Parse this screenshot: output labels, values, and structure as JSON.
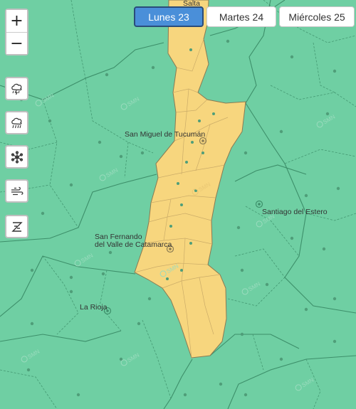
{
  "zoom": {
    "in_label": "+",
    "out_label": "−"
  },
  "layers": [
    {
      "name": "storm-icon"
    },
    {
      "name": "rain-icon"
    },
    {
      "name": "snow-icon"
    },
    {
      "name": "wind-icon"
    },
    {
      "name": "zonda-icon"
    }
  ],
  "days": [
    {
      "label": "Lunes 23",
      "selected": true
    },
    {
      "label": "Martes 24",
      "selected": false
    },
    {
      "label": "Miércoles 25",
      "selected": false
    }
  ],
  "map": {
    "labels": {
      "salta": "Salta",
      "tucuman": "San Miguel de Tucumán",
      "santiago": "Santiago del Estero",
      "catamarca_line1": "San Fernando",
      "catamarca_line2": "del Valle de Catamarca",
      "larioja": "La Rioja"
    },
    "watermark": "SMN",
    "colors": {
      "background": "#6fcfa3",
      "alert_yellow": "#f7d67e",
      "boundary": "#3d8f6a",
      "dot": "#4f9e79"
    },
    "alert_level": "yellow"
  }
}
